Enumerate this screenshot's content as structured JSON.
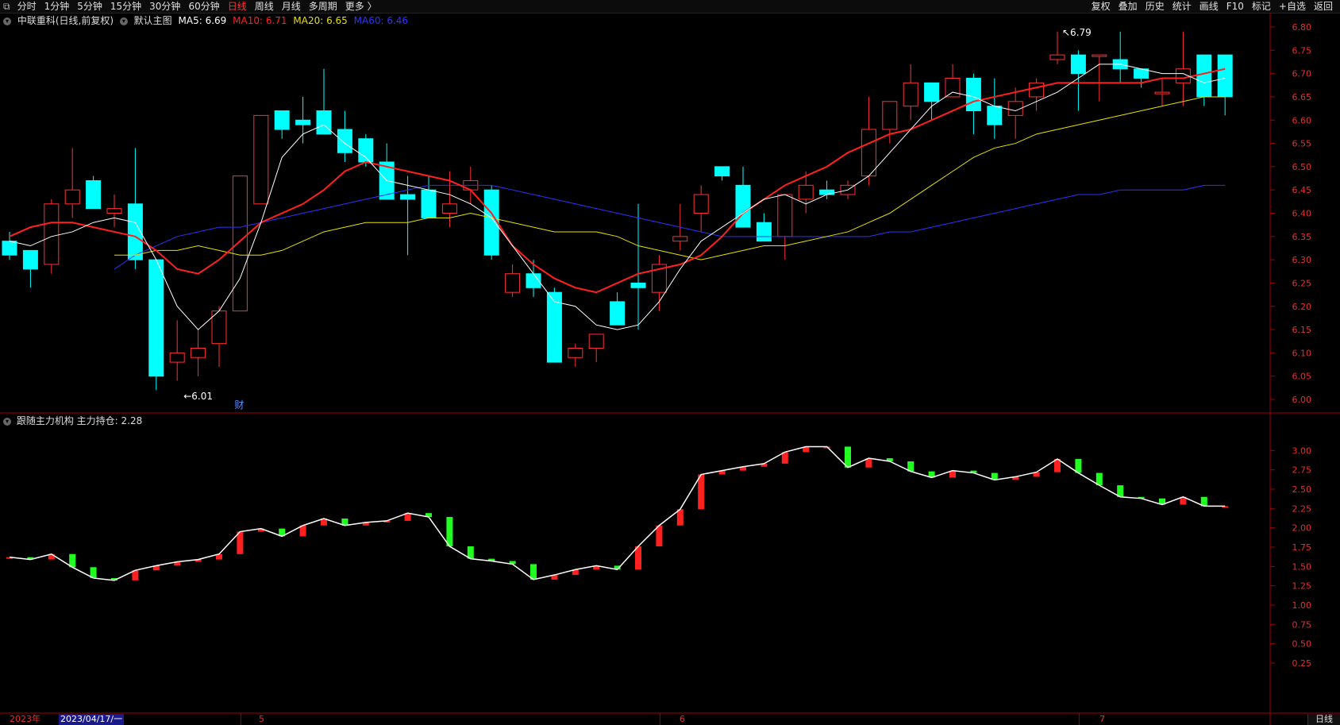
{
  "toolbar": {
    "left_items": [
      "分时",
      "1分钟",
      "5分钟",
      "15分钟",
      "30分钟",
      "60分钟",
      "日线",
      "周线",
      "月线",
      "多周期",
      "更多 〉"
    ],
    "active": "日线",
    "right_items": [
      "复权",
      "叠加",
      "历史",
      "统计",
      "画线",
      "F10",
      "标记",
      "+自选",
      "返回"
    ]
  },
  "main_info": {
    "stock": "中联重科(日线,前复权)",
    "indicator": "默认主图",
    "ma5": "MA5: 6.69",
    "ma10": "MA10: 6.71",
    "ma20": "MA20: 6.65",
    "ma60": "MA60: 6.46",
    "colors": {
      "ma5": "#ffffff",
      "ma10": "#ff2020",
      "ma20": "#e8e000",
      "ma60": "#3030ff"
    }
  },
  "sub_info": {
    "indicator": "跟随主力机构",
    "value": "主力持仓: 2.28"
  },
  "annotations": {
    "high": "6.79",
    "low": "6.01",
    "marker": "财"
  },
  "bottom": {
    "year": "2023年",
    "cursor_date": "2023/04/17/一",
    "months": [
      "5",
      "6",
      "7"
    ],
    "period": "日线"
  },
  "chart_data": [
    {
      "type": "candlestick",
      "ylim": [
        6.0,
        6.8
      ],
      "yticks": [
        "6.80",
        "6.75",
        "6.70",
        "6.65",
        "6.60",
        "6.55",
        "6.50",
        "6.45",
        "6.40",
        "6.35",
        "6.30",
        "6.25",
        "6.20",
        "6.15",
        "6.10",
        "6.05",
        "6.00"
      ],
      "ohlc": [
        [
          6.34,
          6.36,
          6.3,
          6.31
        ],
        [
          6.32,
          6.32,
          6.24,
          6.28
        ],
        [
          6.29,
          6.43,
          6.27,
          6.42
        ],
        [
          6.42,
          6.54,
          6.39,
          6.45
        ],
        [
          6.47,
          6.48,
          6.41,
          6.41
        ],
        [
          6.4,
          6.44,
          6.37,
          6.41
        ],
        [
          6.42,
          6.54,
          6.28,
          6.3
        ],
        [
          6.3,
          6.3,
          6.02,
          6.05
        ],
        [
          6.08,
          6.17,
          6.04,
          6.1
        ],
        [
          6.09,
          6.15,
          6.05,
          6.11
        ],
        [
          6.12,
          6.2,
          6.07,
          6.19
        ],
        [
          6.19,
          6.48,
          6.19,
          6.48
        ],
        [
          6.42,
          6.61,
          6.42,
          6.61
        ],
        [
          6.62,
          6.62,
          6.56,
          6.58
        ],
        [
          6.6,
          6.65,
          6.55,
          6.59
        ],
        [
          6.62,
          6.71,
          6.57,
          6.57
        ],
        [
          6.58,
          6.62,
          6.51,
          6.53
        ],
        [
          6.56,
          6.57,
          6.5,
          6.51
        ],
        [
          6.51,
          6.55,
          6.43,
          6.43
        ],
        [
          6.44,
          6.48,
          6.31,
          6.43
        ],
        [
          6.45,
          6.48,
          6.39,
          6.39
        ],
        [
          6.4,
          6.49,
          6.37,
          6.42
        ],
        [
          6.45,
          6.5,
          6.42,
          6.47
        ],
        [
          6.45,
          6.46,
          6.3,
          6.31
        ],
        [
          6.23,
          6.29,
          6.22,
          6.27
        ],
        [
          6.27,
          6.3,
          6.22,
          6.24
        ],
        [
          6.23,
          6.24,
          6.08,
          6.08
        ],
        [
          6.09,
          6.12,
          6.07,
          6.11
        ],
        [
          6.11,
          6.14,
          6.08,
          6.14
        ],
        [
          6.21,
          6.23,
          6.17,
          6.16
        ],
        [
          6.25,
          6.42,
          6.15,
          6.24
        ],
        [
          6.23,
          6.31,
          6.19,
          6.29
        ],
        [
          6.34,
          6.42,
          6.32,
          6.35
        ],
        [
          6.4,
          6.46,
          6.36,
          6.44
        ],
        [
          6.5,
          6.5,
          6.47,
          6.48
        ],
        [
          6.46,
          6.5,
          6.37,
          6.37
        ],
        [
          6.38,
          6.4,
          6.34,
          6.34
        ],
        [
          6.35,
          6.43,
          6.3,
          6.44
        ],
        [
          6.43,
          6.49,
          6.4,
          6.46
        ],
        [
          6.45,
          6.47,
          6.43,
          6.44
        ],
        [
          6.44,
          6.47,
          6.43,
          6.46
        ],
        [
          6.48,
          6.65,
          6.46,
          6.58
        ],
        [
          6.58,
          6.64,
          6.55,
          6.64
        ],
        [
          6.63,
          6.72,
          6.6,
          6.68
        ],
        [
          6.68,
          6.67,
          6.6,
          6.64
        ],
        [
          6.65,
          6.72,
          6.65,
          6.69
        ],
        [
          6.69,
          6.7,
          6.57,
          6.62
        ],
        [
          6.63,
          6.69,
          6.56,
          6.59
        ],
        [
          6.61,
          6.67,
          6.56,
          6.64
        ],
        [
          6.65,
          6.69,
          6.62,
          6.68
        ],
        [
          6.73,
          6.79,
          6.72,
          6.74
        ],
        [
          6.74,
          6.75,
          6.62,
          6.7
        ],
        [
          6.74,
          6.74,
          6.64,
          6.74
        ],
        [
          6.73,
          6.79,
          6.68,
          6.71
        ],
        [
          6.71,
          6.71,
          6.67,
          6.69
        ],
        [
          6.66,
          6.69,
          6.63,
          6.66
        ],
        [
          6.68,
          6.79,
          6.63,
          6.71
        ],
        [
          6.74,
          6.74,
          6.63,
          6.65
        ],
        [
          6.74,
          6.74,
          6.61,
          6.65
        ]
      ],
      "ma5": [
        6.34,
        6.33,
        6.35,
        6.36,
        6.38,
        6.39,
        6.38,
        6.3,
        6.2,
        6.15,
        6.19,
        6.26,
        6.38,
        6.52,
        6.57,
        6.59,
        6.55,
        6.52,
        6.47,
        6.46,
        6.45,
        6.44,
        6.42,
        6.39,
        6.33,
        6.27,
        6.21,
        6.2,
        6.16,
        6.15,
        6.16,
        6.21,
        6.28,
        6.34,
        6.37,
        6.4,
        6.43,
        6.44,
        6.42,
        6.44,
        6.45,
        6.48,
        6.53,
        6.58,
        6.63,
        6.66,
        6.65,
        6.63,
        6.62,
        6.64,
        6.66,
        6.69,
        6.72,
        6.72,
        6.71,
        6.7,
        6.7,
        6.68,
        6.69
      ],
      "ma10": [
        6.35,
        6.37,
        6.38,
        6.38,
        6.37,
        6.36,
        6.35,
        6.32,
        6.28,
        6.27,
        6.3,
        6.34,
        6.38,
        6.4,
        6.42,
        6.45,
        6.49,
        6.51,
        6.5,
        6.49,
        6.48,
        6.47,
        6.45,
        6.4,
        6.33,
        6.29,
        6.26,
        6.24,
        6.23,
        6.25,
        6.27,
        6.28,
        6.29,
        6.31,
        6.35,
        6.4,
        6.43,
        6.46,
        6.48,
        6.5,
        6.53,
        6.55,
        6.57,
        6.58,
        6.6,
        6.62,
        6.64,
        6.65,
        6.66,
        6.67,
        6.68,
        6.68,
        6.68,
        6.68,
        6.68,
        6.69,
        6.69,
        6.7,
        6.71
      ],
      "ma20": [
        6.31,
        6.31,
        6.32,
        6.32,
        6.33,
        6.32,
        6.31,
        6.31,
        6.32,
        6.34,
        6.36,
        6.37,
        6.38,
        6.38,
        6.38,
        6.39,
        6.39,
        6.4,
        6.39,
        6.38,
        6.37,
        6.36,
        6.36,
        6.36,
        6.35,
        6.33,
        6.32,
        6.31,
        6.3,
        6.31,
        6.32,
        6.33,
        6.33,
        6.34,
        6.35,
        6.36,
        6.38,
        6.4,
        6.43,
        6.46,
        6.49,
        6.52,
        6.54,
        6.55,
        6.57,
        6.58,
        6.59,
        6.6,
        6.61,
        6.62,
        6.63,
        6.64,
        6.65,
        6.65
      ],
      "ma60": [
        6.28,
        6.31,
        6.33,
        6.35,
        6.36,
        6.37,
        6.37,
        6.38,
        6.39,
        6.4,
        6.41,
        6.42,
        6.43,
        6.44,
        6.45,
        6.46,
        6.46,
        6.46,
        6.46,
        6.45,
        6.44,
        6.43,
        6.42,
        6.41,
        6.4,
        6.39,
        6.38,
        6.37,
        6.36,
        6.35,
        6.35,
        6.35,
        6.35,
        6.35,
        6.35,
        6.35,
        6.35,
        6.36,
        6.36,
        6.37,
        6.38,
        6.39,
        6.4,
        6.41,
        6.42,
        6.43,
        6.44,
        6.44,
        6.45,
        6.45,
        6.45,
        6.45,
        6.46,
        6.46
      ]
    },
    {
      "type": "bar",
      "ylim": [
        0.25,
        3.25
      ],
      "yticks": [
        "3.00",
        "2.75",
        "2.50",
        "2.25",
        "2.00",
        "1.75",
        "1.50",
        "1.25",
        "1.00",
        "0.75",
        "0.50",
        "0.25"
      ],
      "values": [
        1.62,
        1.59,
        1.66,
        1.49,
        1.35,
        1.32,
        1.45,
        1.51,
        1.56,
        1.59,
        1.66,
        1.95,
        1.99,
        1.89,
        2.03,
        2.12,
        2.03,
        2.07,
        2.09,
        2.19,
        2.14,
        1.76,
        1.6,
        1.57,
        1.53,
        1.33,
        1.39,
        1.46,
        1.51,
        1.46,
        1.76,
        2.03,
        2.24,
        2.69,
        2.74,
        2.79,
        2.83,
        2.98,
        3.05,
        3.05,
        2.78,
        2.9,
        2.86,
        2.73,
        2.65,
        2.74,
        2.71,
        2.62,
        2.66,
        2.72,
        2.89,
        2.71,
        2.55,
        2.4,
        2.38,
        2.3,
        2.4,
        2.28,
        2.28
      ]
    }
  ]
}
